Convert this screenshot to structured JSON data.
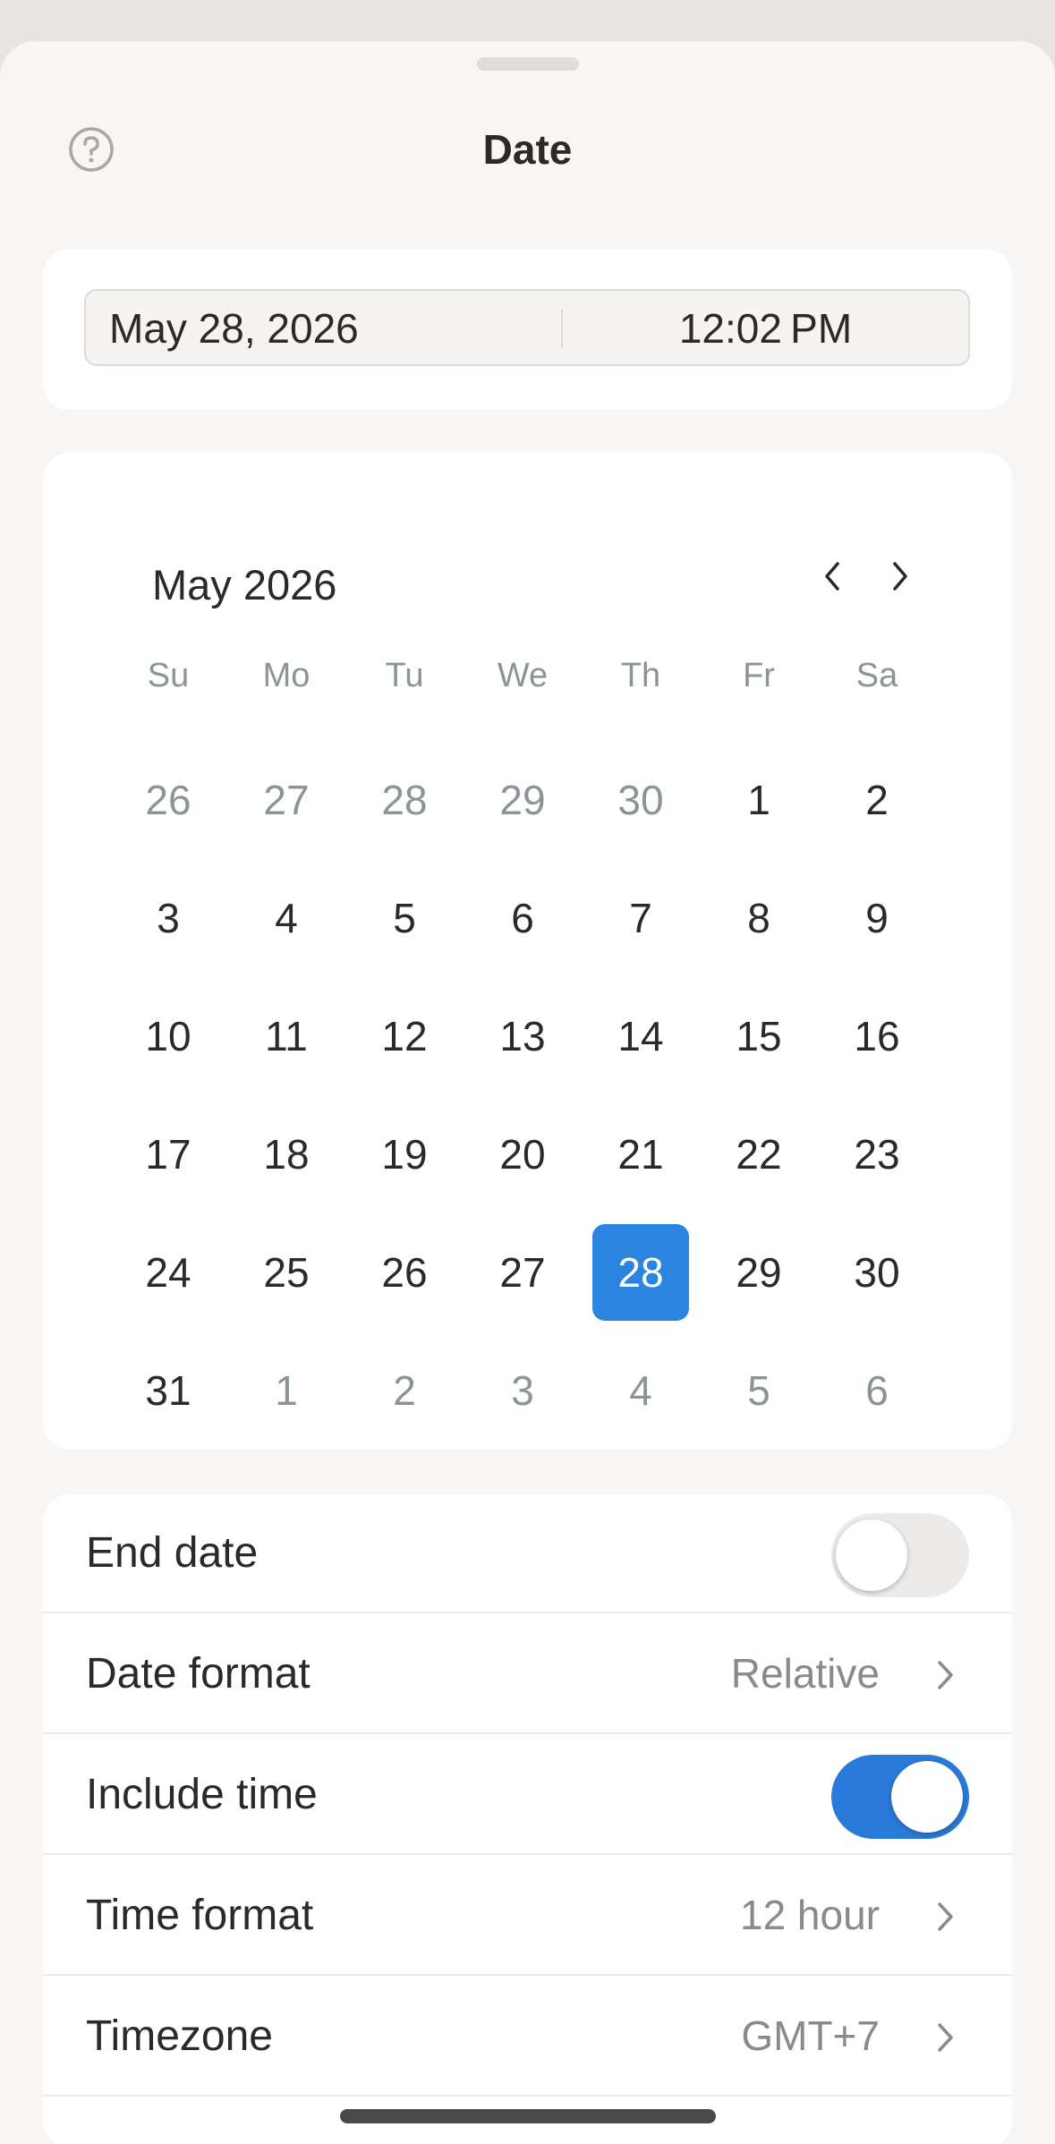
{
  "sheet": {
    "title": "Date",
    "help_icon": "question-circle-icon"
  },
  "datetime": {
    "date": "May 28, 2026",
    "time": "12:02 PM"
  },
  "calendar": {
    "month_label": "May 2026",
    "prev_icon": "chevron-left-icon",
    "next_icon": "chevron-right-icon",
    "weekdays": [
      "Su",
      "Mo",
      "Tu",
      "We",
      "Th",
      "Fr",
      "Sa"
    ],
    "days": [
      {
        "label": "26",
        "muted": true
      },
      {
        "label": "27",
        "muted": true
      },
      {
        "label": "28",
        "muted": true
      },
      {
        "label": "29",
        "muted": true
      },
      {
        "label": "30",
        "muted": true
      },
      {
        "label": "1",
        "muted": false
      },
      {
        "label": "2",
        "muted": false
      },
      {
        "label": "3",
        "muted": false
      },
      {
        "label": "4",
        "muted": false
      },
      {
        "label": "5",
        "muted": false
      },
      {
        "label": "6",
        "muted": false
      },
      {
        "label": "7",
        "muted": false
      },
      {
        "label": "8",
        "muted": false
      },
      {
        "label": "9",
        "muted": false
      },
      {
        "label": "10",
        "muted": false
      },
      {
        "label": "11",
        "muted": false
      },
      {
        "label": "12",
        "muted": false
      },
      {
        "label": "13",
        "muted": false
      },
      {
        "label": "14",
        "muted": false
      },
      {
        "label": "15",
        "muted": false
      },
      {
        "label": "16",
        "muted": false
      },
      {
        "label": "17",
        "muted": false
      },
      {
        "label": "18",
        "muted": false
      },
      {
        "label": "19",
        "muted": false
      },
      {
        "label": "20",
        "muted": false
      },
      {
        "label": "21",
        "muted": false
      },
      {
        "label": "22",
        "muted": false
      },
      {
        "label": "23",
        "muted": false
      },
      {
        "label": "24",
        "muted": false
      },
      {
        "label": "25",
        "muted": false
      },
      {
        "label": "26",
        "muted": false
      },
      {
        "label": "27",
        "muted": false
      },
      {
        "label": "28",
        "muted": false,
        "selected": true
      },
      {
        "label": "29",
        "muted": false
      },
      {
        "label": "30",
        "muted": false
      },
      {
        "label": "31",
        "muted": false
      },
      {
        "label": "1",
        "muted": true
      },
      {
        "label": "2",
        "muted": true
      },
      {
        "label": "3",
        "muted": true
      },
      {
        "label": "4",
        "muted": true
      },
      {
        "label": "5",
        "muted": true
      },
      {
        "label": "6",
        "muted": true
      }
    ],
    "selected_color": "#2a84e0"
  },
  "settings": {
    "end_date": {
      "label": "End date",
      "enabled": false
    },
    "date_format": {
      "label": "Date format",
      "value": "Relative"
    },
    "include_time": {
      "label": "Include time",
      "enabled": true
    },
    "time_format": {
      "label": "Time format",
      "value": "12 hour"
    },
    "timezone": {
      "label": "Timezone",
      "value": "GMT+7"
    },
    "toggle_on_color": "#2a7ad9"
  }
}
